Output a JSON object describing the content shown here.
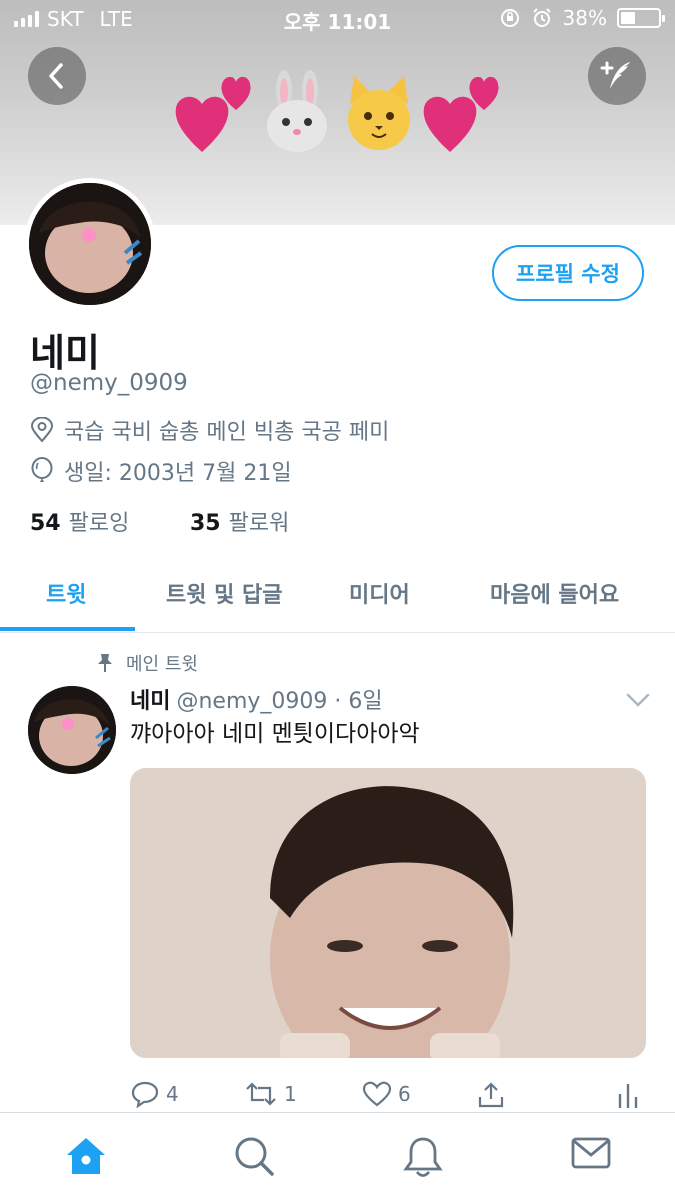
{
  "status_bar": {
    "carrier": "SKT",
    "network": "LTE",
    "time": "오후 11:01",
    "battery_percent": "38%",
    "battery_level": 0.38
  },
  "header": {
    "back_icon": "chevron-left-icon",
    "compose_icon": "compose-tweet-icon",
    "banner_emoji": [
      "heart",
      "rabbit-face",
      "cat-face",
      "heart"
    ]
  },
  "profile": {
    "edit_label": "프로필 수정",
    "name": "네미",
    "handle": "@nemy_0909",
    "location": "국습 국비 숩총 메인 빅총 국공 페미",
    "birthday": "생일: 2003년 7월 21일",
    "following_count": "54",
    "following_label": "팔로잉",
    "followers_count": "35",
    "followers_label": "팔로워"
  },
  "tabs": [
    {
      "label": "트윗",
      "active": true
    },
    {
      "label": "트윗 및 답글",
      "active": false
    },
    {
      "label": "미디어",
      "active": false
    },
    {
      "label": "마음에 들어요",
      "active": false
    }
  ],
  "tweet": {
    "pinned_label": "메인 트윗",
    "author_name": "네미",
    "author_handle": "@nemy_0909",
    "separator": "·",
    "age": "6일",
    "text": "꺄아아아 네미 멘틧이다아아악",
    "replies": "4",
    "retweets": "1",
    "likes": "6"
  },
  "bottom_nav": [
    "home-icon",
    "search-icon",
    "notifications-icon",
    "messages-icon"
  ],
  "colors": {
    "accent": "#1da1f2",
    "heart": "#e0307a",
    "secondary_text": "#657786"
  }
}
